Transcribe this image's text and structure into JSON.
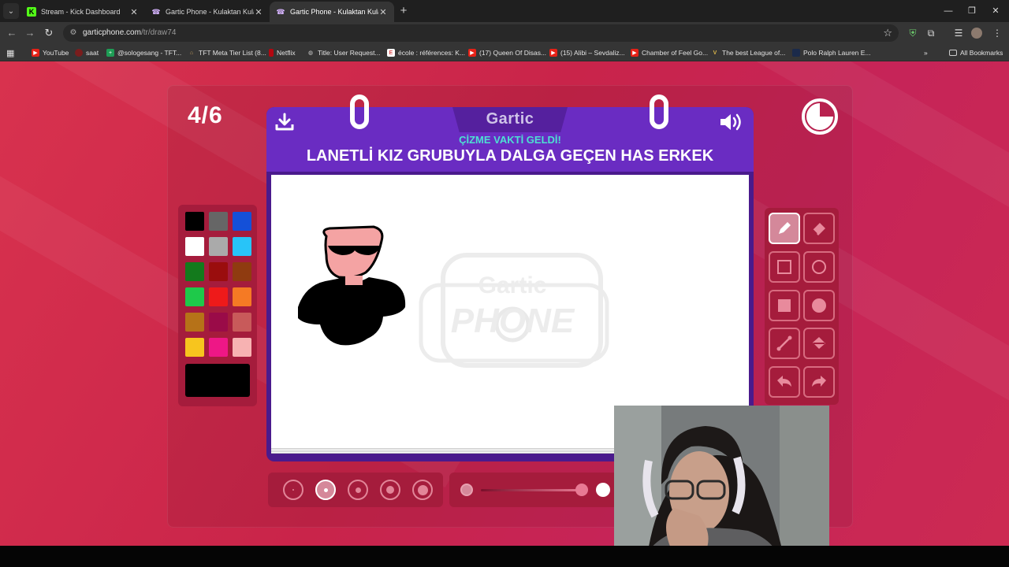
{
  "browser": {
    "tabs": [
      {
        "title": "Stream - Kick Dashboard",
        "favicon": "kick-icon",
        "active": false
      },
      {
        "title": "Gartic Phone - Kulaktan Kulağa",
        "favicon": "gartic-icon",
        "active": false
      },
      {
        "title": "Gartic Phone - Kulaktan Kulağa",
        "favicon": "gartic-icon",
        "active": true
      }
    ],
    "url_domain": "garticphone.com",
    "url_path": "/tr/draw74",
    "bookmarks": [
      "YouTube",
      "saat",
      "@sologesang - TFT...",
      "TFT Meta Tier List (8...",
      "Netflix",
      "Title: User Request...",
      "école : références: K...",
      "(17) Queen Of Disas...",
      "(15) Alibi – Sevdaliz...",
      "Chamber of Feel Go...",
      "The best League of...",
      "Polo Ralph Lauren E..."
    ],
    "all_bookmarks": "All Bookmarks"
  },
  "game": {
    "round": "4/6",
    "logo": "Gartic",
    "prompt_subtitle": "ÇİZME VAKTİ GELDİ!",
    "prompt": "LANETLİ KIZ GRUBUYLA DALGA GEÇEN HAS ERKEK",
    "watermark_line1": "Gartic",
    "watermark_line2": "PHONE",
    "timer_remaining_fraction": 0.75,
    "palette": [
      "#000000",
      "#666666",
      "#1450d8",
      "#ffffff",
      "#aaaaaa",
      "#28c4f8",
      "#137a1c",
      "#9a0d0d",
      "#8f3b10",
      "#1ec94a",
      "#ee1a1a",
      "#f57a24",
      "#b67218",
      "#9a0b48",
      "#c85a5a",
      "#f7c51e",
      "#ee1786",
      "#f7b2b2"
    ],
    "current_color": "#000000",
    "tools": [
      "pencil-tool",
      "eraser-tool",
      "rectangle-outline-tool",
      "circle-outline-tool",
      "rectangle-fill-tool",
      "circle-fill-tool",
      "line-tool",
      "bucket-tool",
      "undo-tool",
      "redo-tool"
    ],
    "selected_tool": "pencil-tool",
    "brush_sizes": 5,
    "selected_brush": 2
  }
}
